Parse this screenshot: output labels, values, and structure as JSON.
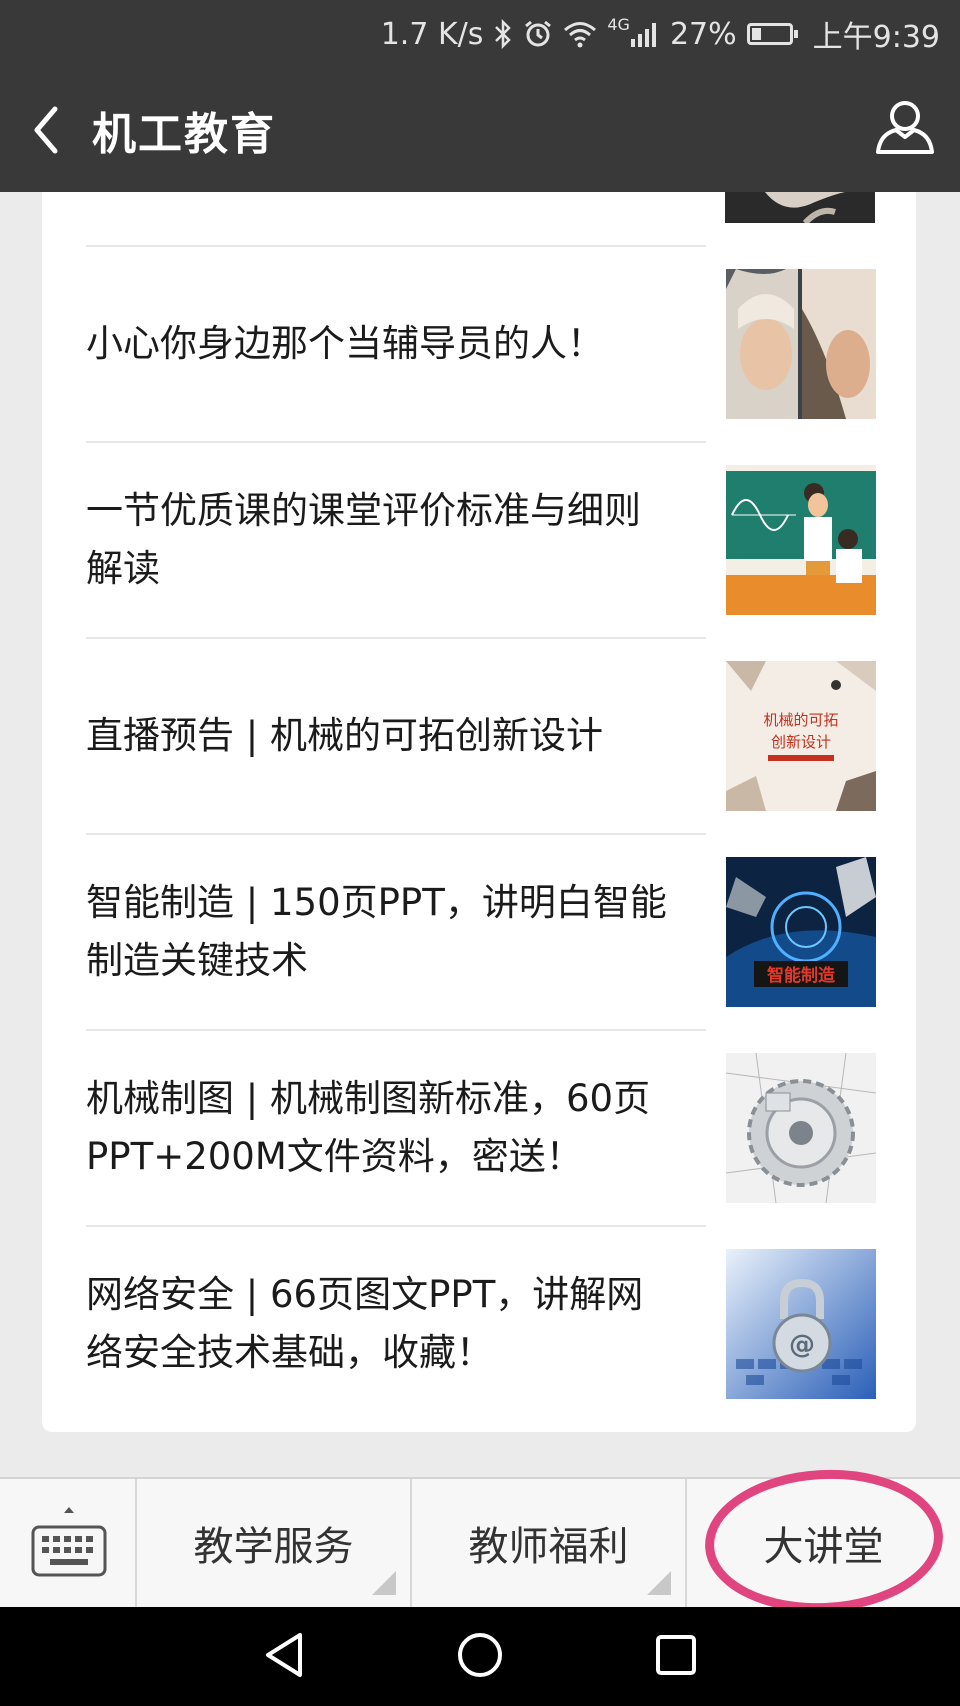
{
  "status_bar": {
    "net_speed": "1.7 K/s",
    "signal": "4G",
    "battery": "27%",
    "battery_level": 0.27,
    "time": "上午9:39",
    "icons": [
      "bluetooth-icon",
      "alarm-icon",
      "wifi-icon",
      "signal-icon",
      "battery-icon"
    ]
  },
  "nav": {
    "title": "机工教育",
    "back_icon": "back-arrow-icon",
    "profile_icon": "profile-icon"
  },
  "articles": [
    {
      "title": "小心你身边那个当辅导员的人！",
      "thumb": "woman-portrait-thumbnail"
    },
    {
      "title": "一节优质课的课堂评价标准与细则解读",
      "thumb": "classroom-illustration-thumbnail"
    },
    {
      "title": "直播预告 | 机械的可拓创新设计",
      "thumb": "design-poster-thumbnail",
      "thumb_text": [
        "机械的可拓",
        "创新设计"
      ]
    },
    {
      "title": "智能制造 | 150页PPT，讲明白智能制造关键技术",
      "thumb": "robot-arm-thumbnail",
      "thumb_text": [
        "智能制造"
      ]
    },
    {
      "title": "机械制图 | 机械制图新标准，60页PPT+200M文件资料，密送！",
      "thumb": "gear-drawing-thumbnail"
    },
    {
      "title": "网络安全 | 66页图文PPT，讲解网络安全技术基础，收藏！",
      "thumb": "security-lock-thumbnail"
    }
  ],
  "menu": {
    "keyboard_icon": "keyboard-icon",
    "items": [
      {
        "label": "教学服务",
        "has_submenu": true
      },
      {
        "label": "教师福利",
        "has_submenu": true
      },
      {
        "label": "大讲堂",
        "has_submenu": false,
        "highlighted": true
      }
    ],
    "highlight_color": "#e0457f"
  },
  "system_nav": [
    "back-triangle-icon",
    "home-circle-icon",
    "recents-square-icon"
  ]
}
